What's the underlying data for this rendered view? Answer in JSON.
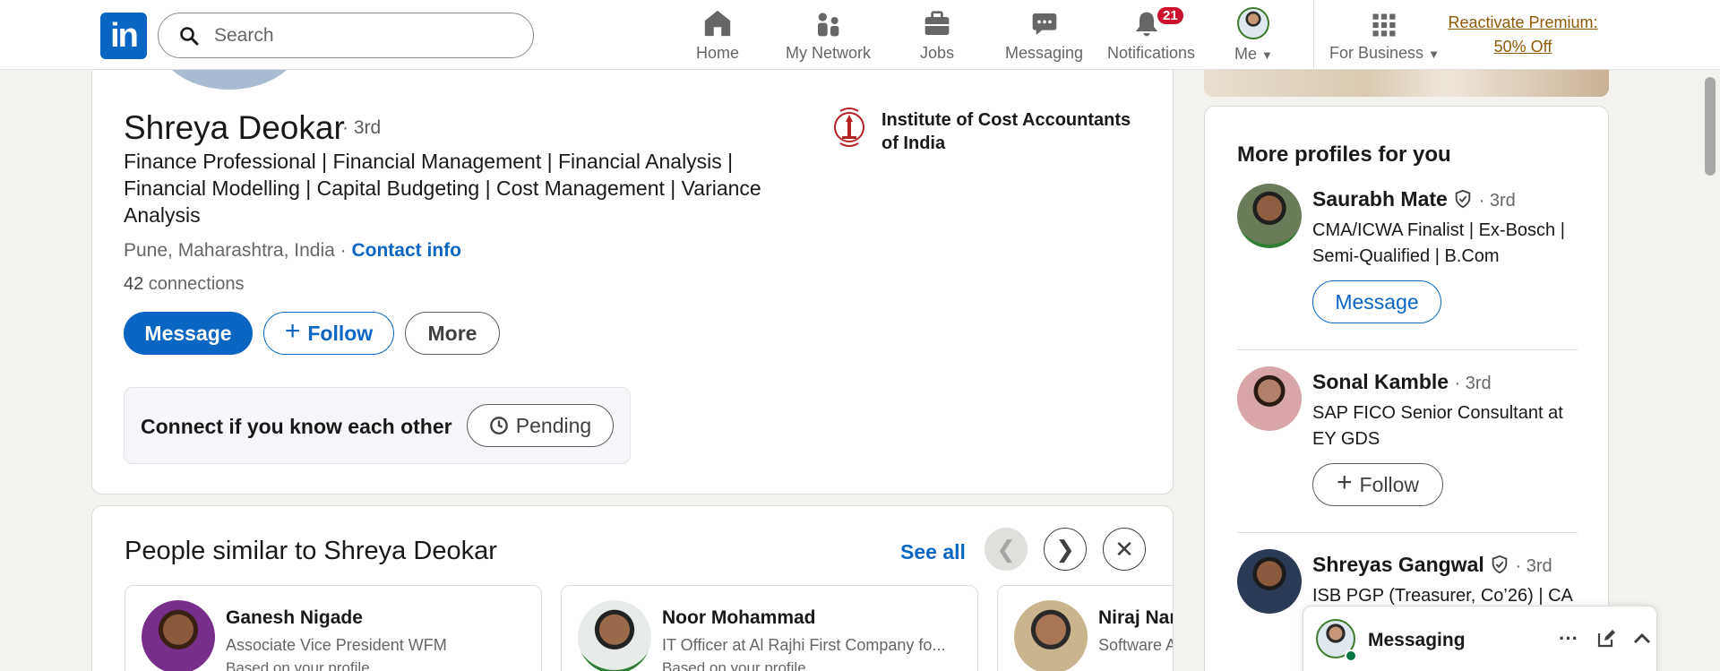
{
  "nav": {
    "logo": "in",
    "search_placeholder": "Search",
    "items": [
      {
        "label": "Home",
        "icon": "home-icon"
      },
      {
        "label": "My Network",
        "icon": "network-icon"
      },
      {
        "label": "Jobs",
        "icon": "briefcase-icon"
      },
      {
        "label": "Messaging",
        "icon": "chat-icon"
      },
      {
        "label": "Notifications",
        "icon": "bell-icon",
        "badge": "21"
      },
      {
        "label": "Me",
        "icon": "avatar"
      },
      {
        "label": "For Business",
        "icon": "grid-icon"
      }
    ],
    "premium_line1": "Reactivate Premium:",
    "premium_line2": "50% Off"
  },
  "profile": {
    "name": "Shreya Deokar",
    "degree": "· 3rd",
    "headline": "Finance Professional | Financial Management | Financial Analysis | Financial Modelling | Capital Budgeting | Cost Management | Variance Analysis",
    "location": "Pune, Maharashtra, India",
    "location_sep": " · ",
    "contact_info": "Contact info",
    "connections_count": "42",
    "connections_label": " connections",
    "message_button": "Message",
    "follow_button": "Follow",
    "more_button": "More",
    "institute": "Institute of Cost Accountants of India",
    "connect_prompt": "Connect if you know each other",
    "pending_button": "Pending"
  },
  "similar": {
    "title": "People similar to Shreya Deokar",
    "see_all": "See all",
    "prev": "❮",
    "next": "❯",
    "close": "✕",
    "people": [
      {
        "name": "Ganesh Nigade",
        "headline": "Associate Vice President WFM",
        "reason": "Based on your profile"
      },
      {
        "name": "Noor Mohammad",
        "headline": "IT Officer at Al Rajhi First Company fo...",
        "reason": "Based on your profile"
      },
      {
        "name": "Niraj Nar",
        "headline": "Software A",
        "reason": ""
      }
    ]
  },
  "sidebar": {
    "title": "More profiles for you",
    "profiles": [
      {
        "name": "Saurabh Mate",
        "degree": "· 3rd",
        "verified": true,
        "headline": "CMA/ICWA Finalist | Ex-Bosch | Semi-Qualified | B.Com",
        "button": "Message"
      },
      {
        "name": "Sonal Kamble",
        "degree": "· 3rd",
        "verified": false,
        "headline": "SAP FICO Senior Consultant at EY GDS",
        "button": "Follow"
      },
      {
        "name": "Shreyas Gangwal",
        "degree": "· 3rd",
        "verified": true,
        "headline": "ISB PGP (Treasurer, Co’26) | CA |",
        "button": ""
      }
    ]
  },
  "messaging": {
    "label": "Messaging",
    "more": "···"
  },
  "colors": {
    "brand_blue": "#0a66c2",
    "premium_gold": "#915907",
    "badge_red": "#cb112d",
    "online_green": "#057642"
  }
}
